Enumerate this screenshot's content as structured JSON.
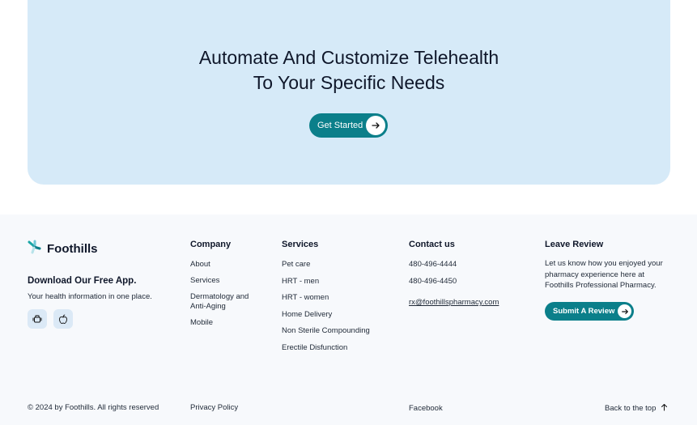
{
  "cta": {
    "title_line1": "Automate And Customize Telehealth",
    "title_line2": "To Your Specific Needs",
    "button_label": "Get Started"
  },
  "footer": {
    "brand": "Foothills",
    "app_title": "Download Our Free App.",
    "app_subtitle": "Your health information in one place.",
    "store_icons": [
      "android-icon",
      "apple-icon"
    ],
    "company": {
      "heading": "Company",
      "links": [
        "About",
        "Services",
        "Dermatology and Anti-Aging",
        "Mobile"
      ]
    },
    "services": {
      "heading": "Services",
      "links": [
        "Pet care",
        "HRT - men",
        "HRT - women",
        "Home Delivery",
        "Non Sterile Compounding",
        "Erectile Disfunction"
      ]
    },
    "contact": {
      "heading": "Contact us",
      "phone1": "480-496-4444",
      "phone2": "480-496-4450",
      "email": "rx@foothillspharmacy.com"
    },
    "review": {
      "heading": "Leave Review",
      "text": "Let us know how you enjoyed your pharmacy experience here at Foothills Professional Pharmacy.",
      "button_label": "Submit A Review"
    },
    "bottom": {
      "copyright": "© 2024 by Foothills. All rights reserved",
      "privacy": "Privacy Policy",
      "facebook": "Facebook",
      "back_to_top": "Back to the top"
    }
  },
  "colors": {
    "banner": "#d6eaf8",
    "accent": "#0b7f8a",
    "footer_bg": "#f7f9fc"
  }
}
